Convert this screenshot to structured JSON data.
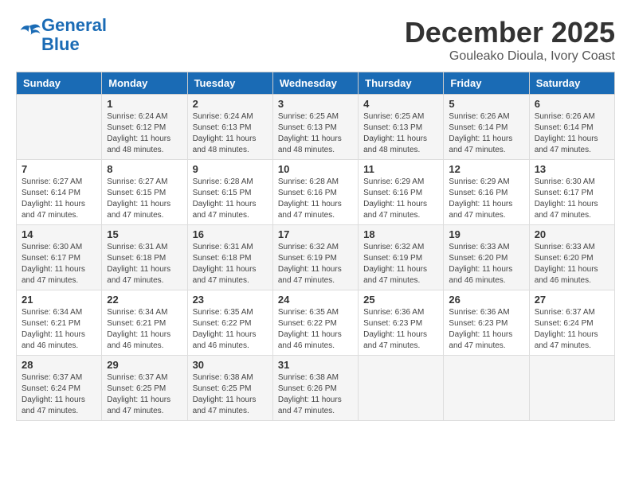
{
  "header": {
    "logo_line1": "General",
    "logo_line2": "Blue",
    "month_title": "December 2025",
    "subtitle": "Gouleako Dioula, Ivory Coast"
  },
  "weekdays": [
    "Sunday",
    "Monday",
    "Tuesday",
    "Wednesday",
    "Thursday",
    "Friday",
    "Saturday"
  ],
  "weeks": [
    [
      {
        "day": "",
        "info": ""
      },
      {
        "day": "1",
        "info": "Sunrise: 6:24 AM\nSunset: 6:12 PM\nDaylight: 11 hours\nand 48 minutes."
      },
      {
        "day": "2",
        "info": "Sunrise: 6:24 AM\nSunset: 6:13 PM\nDaylight: 11 hours\nand 48 minutes."
      },
      {
        "day": "3",
        "info": "Sunrise: 6:25 AM\nSunset: 6:13 PM\nDaylight: 11 hours\nand 48 minutes."
      },
      {
        "day": "4",
        "info": "Sunrise: 6:25 AM\nSunset: 6:13 PM\nDaylight: 11 hours\nand 48 minutes."
      },
      {
        "day": "5",
        "info": "Sunrise: 6:26 AM\nSunset: 6:14 PM\nDaylight: 11 hours\nand 47 minutes."
      },
      {
        "day": "6",
        "info": "Sunrise: 6:26 AM\nSunset: 6:14 PM\nDaylight: 11 hours\nand 47 minutes."
      }
    ],
    [
      {
        "day": "7",
        "info": "Sunrise: 6:27 AM\nSunset: 6:14 PM\nDaylight: 11 hours\nand 47 minutes."
      },
      {
        "day": "8",
        "info": "Sunrise: 6:27 AM\nSunset: 6:15 PM\nDaylight: 11 hours\nand 47 minutes."
      },
      {
        "day": "9",
        "info": "Sunrise: 6:28 AM\nSunset: 6:15 PM\nDaylight: 11 hours\nand 47 minutes."
      },
      {
        "day": "10",
        "info": "Sunrise: 6:28 AM\nSunset: 6:16 PM\nDaylight: 11 hours\nand 47 minutes."
      },
      {
        "day": "11",
        "info": "Sunrise: 6:29 AM\nSunset: 6:16 PM\nDaylight: 11 hours\nand 47 minutes."
      },
      {
        "day": "12",
        "info": "Sunrise: 6:29 AM\nSunset: 6:16 PM\nDaylight: 11 hours\nand 47 minutes."
      },
      {
        "day": "13",
        "info": "Sunrise: 6:30 AM\nSunset: 6:17 PM\nDaylight: 11 hours\nand 47 minutes."
      }
    ],
    [
      {
        "day": "14",
        "info": "Sunrise: 6:30 AM\nSunset: 6:17 PM\nDaylight: 11 hours\nand 47 minutes."
      },
      {
        "day": "15",
        "info": "Sunrise: 6:31 AM\nSunset: 6:18 PM\nDaylight: 11 hours\nand 47 minutes."
      },
      {
        "day": "16",
        "info": "Sunrise: 6:31 AM\nSunset: 6:18 PM\nDaylight: 11 hours\nand 47 minutes."
      },
      {
        "day": "17",
        "info": "Sunrise: 6:32 AM\nSunset: 6:19 PM\nDaylight: 11 hours\nand 47 minutes."
      },
      {
        "day": "18",
        "info": "Sunrise: 6:32 AM\nSunset: 6:19 PM\nDaylight: 11 hours\nand 47 minutes."
      },
      {
        "day": "19",
        "info": "Sunrise: 6:33 AM\nSunset: 6:20 PM\nDaylight: 11 hours\nand 46 minutes."
      },
      {
        "day": "20",
        "info": "Sunrise: 6:33 AM\nSunset: 6:20 PM\nDaylight: 11 hours\nand 46 minutes."
      }
    ],
    [
      {
        "day": "21",
        "info": "Sunrise: 6:34 AM\nSunset: 6:21 PM\nDaylight: 11 hours\nand 46 minutes."
      },
      {
        "day": "22",
        "info": "Sunrise: 6:34 AM\nSunset: 6:21 PM\nDaylight: 11 hours\nand 46 minutes."
      },
      {
        "day": "23",
        "info": "Sunrise: 6:35 AM\nSunset: 6:22 PM\nDaylight: 11 hours\nand 46 minutes."
      },
      {
        "day": "24",
        "info": "Sunrise: 6:35 AM\nSunset: 6:22 PM\nDaylight: 11 hours\nand 46 minutes."
      },
      {
        "day": "25",
        "info": "Sunrise: 6:36 AM\nSunset: 6:23 PM\nDaylight: 11 hours\nand 47 minutes."
      },
      {
        "day": "26",
        "info": "Sunrise: 6:36 AM\nSunset: 6:23 PM\nDaylight: 11 hours\nand 47 minutes."
      },
      {
        "day": "27",
        "info": "Sunrise: 6:37 AM\nSunset: 6:24 PM\nDaylight: 11 hours\nand 47 minutes."
      }
    ],
    [
      {
        "day": "28",
        "info": "Sunrise: 6:37 AM\nSunset: 6:24 PM\nDaylight: 11 hours\nand 47 minutes."
      },
      {
        "day": "29",
        "info": "Sunrise: 6:37 AM\nSunset: 6:25 PM\nDaylight: 11 hours\nand 47 minutes."
      },
      {
        "day": "30",
        "info": "Sunrise: 6:38 AM\nSunset: 6:25 PM\nDaylight: 11 hours\nand 47 minutes."
      },
      {
        "day": "31",
        "info": "Sunrise: 6:38 AM\nSunset: 6:26 PM\nDaylight: 11 hours\nand 47 minutes."
      },
      {
        "day": "",
        "info": ""
      },
      {
        "day": "",
        "info": ""
      },
      {
        "day": "",
        "info": ""
      }
    ]
  ]
}
